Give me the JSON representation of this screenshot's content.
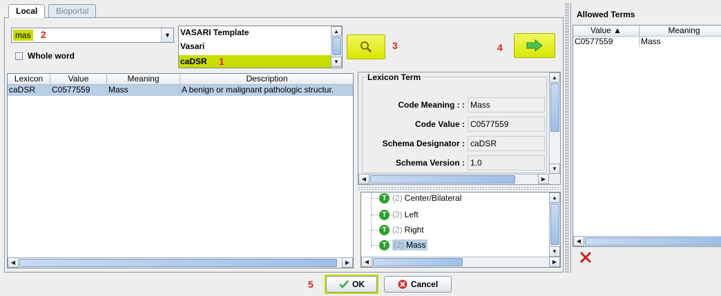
{
  "tabs": [
    {
      "label": "Local"
    },
    {
      "label": "Bioportal"
    }
  ],
  "search": {
    "value": "mas",
    "step": "2",
    "whole_word_label": "Whole word"
  },
  "sources": {
    "items": [
      "VASARI Template",
      "Vasari",
      "caDSR"
    ],
    "step": "1"
  },
  "search_button": {
    "step": "3",
    "icon": "magnifier-icon"
  },
  "add_button": {
    "step": "4",
    "icon": "arrow-right-icon"
  },
  "results": {
    "headers": [
      "Lexicon",
      "Value",
      "Meaning",
      "Description"
    ],
    "rows": [
      {
        "lexicon": "caDSR",
        "value": "C0577559",
        "meaning": "Mass",
        "description": "A benign or malignant pathologic structur."
      }
    ]
  },
  "lexicon_term": {
    "title": "Lexicon Term",
    "fields": [
      {
        "label": "Code Meaning : :",
        "value": "Mass"
      },
      {
        "label": "Code Value :",
        "value": "C0577559"
      },
      {
        "label": "Schema Designator :",
        "value": "caDSR"
      },
      {
        "label": "Schema Version :",
        "value": "1.0"
      }
    ]
  },
  "tree": {
    "items": [
      {
        "count": "(2)",
        "label": "Center/Bilateral"
      },
      {
        "count": "(2)",
        "label": "Left"
      },
      {
        "count": "(2)",
        "label": "Right"
      },
      {
        "count": "(2)",
        "label": "Mass"
      }
    ]
  },
  "allowed_terms": {
    "title": "Allowed Terms",
    "headers": [
      "Value ▲",
      "Meaning"
    ],
    "rows": [
      {
        "value": "C0577559",
        "meaning": "Mass"
      }
    ]
  },
  "footer": {
    "step": "5",
    "ok_label": "OK",
    "cancel_label": "Cancel"
  },
  "colors": {
    "highlight": "#c8dc00",
    "step_number": "#e02020",
    "tree_icon": "#2ea02e",
    "selection": "#b8cfe5"
  }
}
